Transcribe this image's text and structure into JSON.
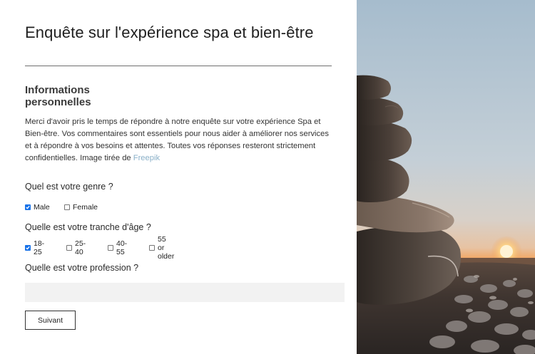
{
  "form": {
    "title": "Enquête sur l'expérience spa et bien-être",
    "section_heading": "Informations personnelles",
    "intro_text": "Merci d'avoir pris le temps de répondre à notre enquête sur votre expérience Spa et Bien-être. Vos commentaires sont essentiels pour nous aider à améliorer nos services et à répondre à vos besoins et attentes. Toutes vos réponses resteront strictement confidentielles. Image tirée de ",
    "intro_link": "Freepik",
    "questions": [
      {
        "label": "Quel est votre genre ?",
        "options": [
          {
            "label": "Male",
            "checked": true
          },
          {
            "label": "Female",
            "checked": false
          }
        ]
      },
      {
        "label": "Quelle est votre tranche d'âge ?",
        "options": [
          {
            "label": "18-25",
            "checked": true
          },
          {
            "label": "25-40",
            "checked": false
          },
          {
            "label": "40-55",
            "checked": false
          },
          {
            "label": "55 or older",
            "checked": false
          }
        ]
      },
      {
        "label": "Quelle est votre profession ?",
        "input_value": "",
        "input_placeholder": ""
      }
    ],
    "next_button_label": "Suivant"
  },
  "colors": {
    "accent": "#1a73e8",
    "link": "#8ab0c8",
    "input_bg": "#f2f2f2"
  }
}
